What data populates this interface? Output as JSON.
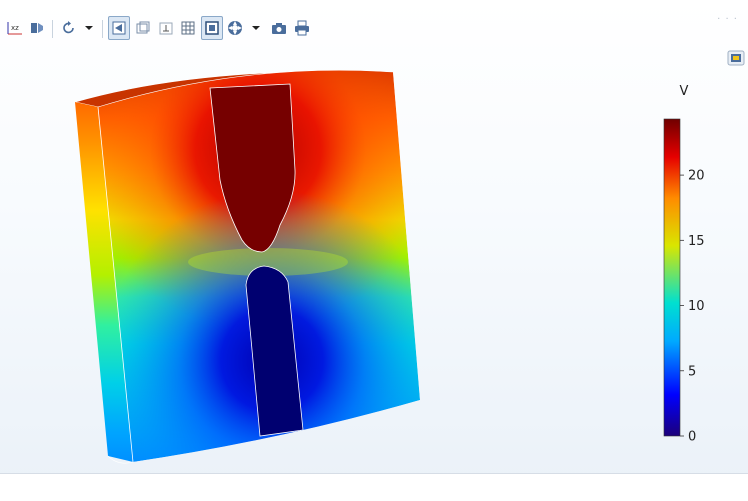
{
  "toolbar": {
    "buttons": [
      {
        "name": "axis-labels-icon",
        "text": "xz"
      },
      {
        "name": "view-toggle-icon"
      },
      {
        "name": "rotate-icon"
      },
      {
        "name": "dropdown-arrow-icon"
      },
      {
        "name": "transparency-icon",
        "active": true
      },
      {
        "name": "wireframe-icon"
      },
      {
        "name": "axis-orientation-icon"
      },
      {
        "name": "grid-icon"
      },
      {
        "name": "frame-icon",
        "active": true
      },
      {
        "name": "scene-light-icon"
      },
      {
        "name": "dropdown-arrow-icon"
      },
      {
        "name": "camera-icon"
      },
      {
        "name": "print-icon"
      }
    ]
  },
  "colorbar": {
    "unit": "V",
    "ticks": [
      "0",
      "5",
      "10",
      "15",
      "20"
    ],
    "min": 0,
    "max": 24.3,
    "colormap": "rainbow",
    "colors": [
      "#1c007a",
      "#0000ff",
      "#00aaff",
      "#00e0d0",
      "#d9e600",
      "#ff8c00",
      "#e60000",
      "#700000"
    ]
  },
  "plot": {
    "type": "3D surface plot",
    "geometry": "block with rounded electrodes"
  }
}
